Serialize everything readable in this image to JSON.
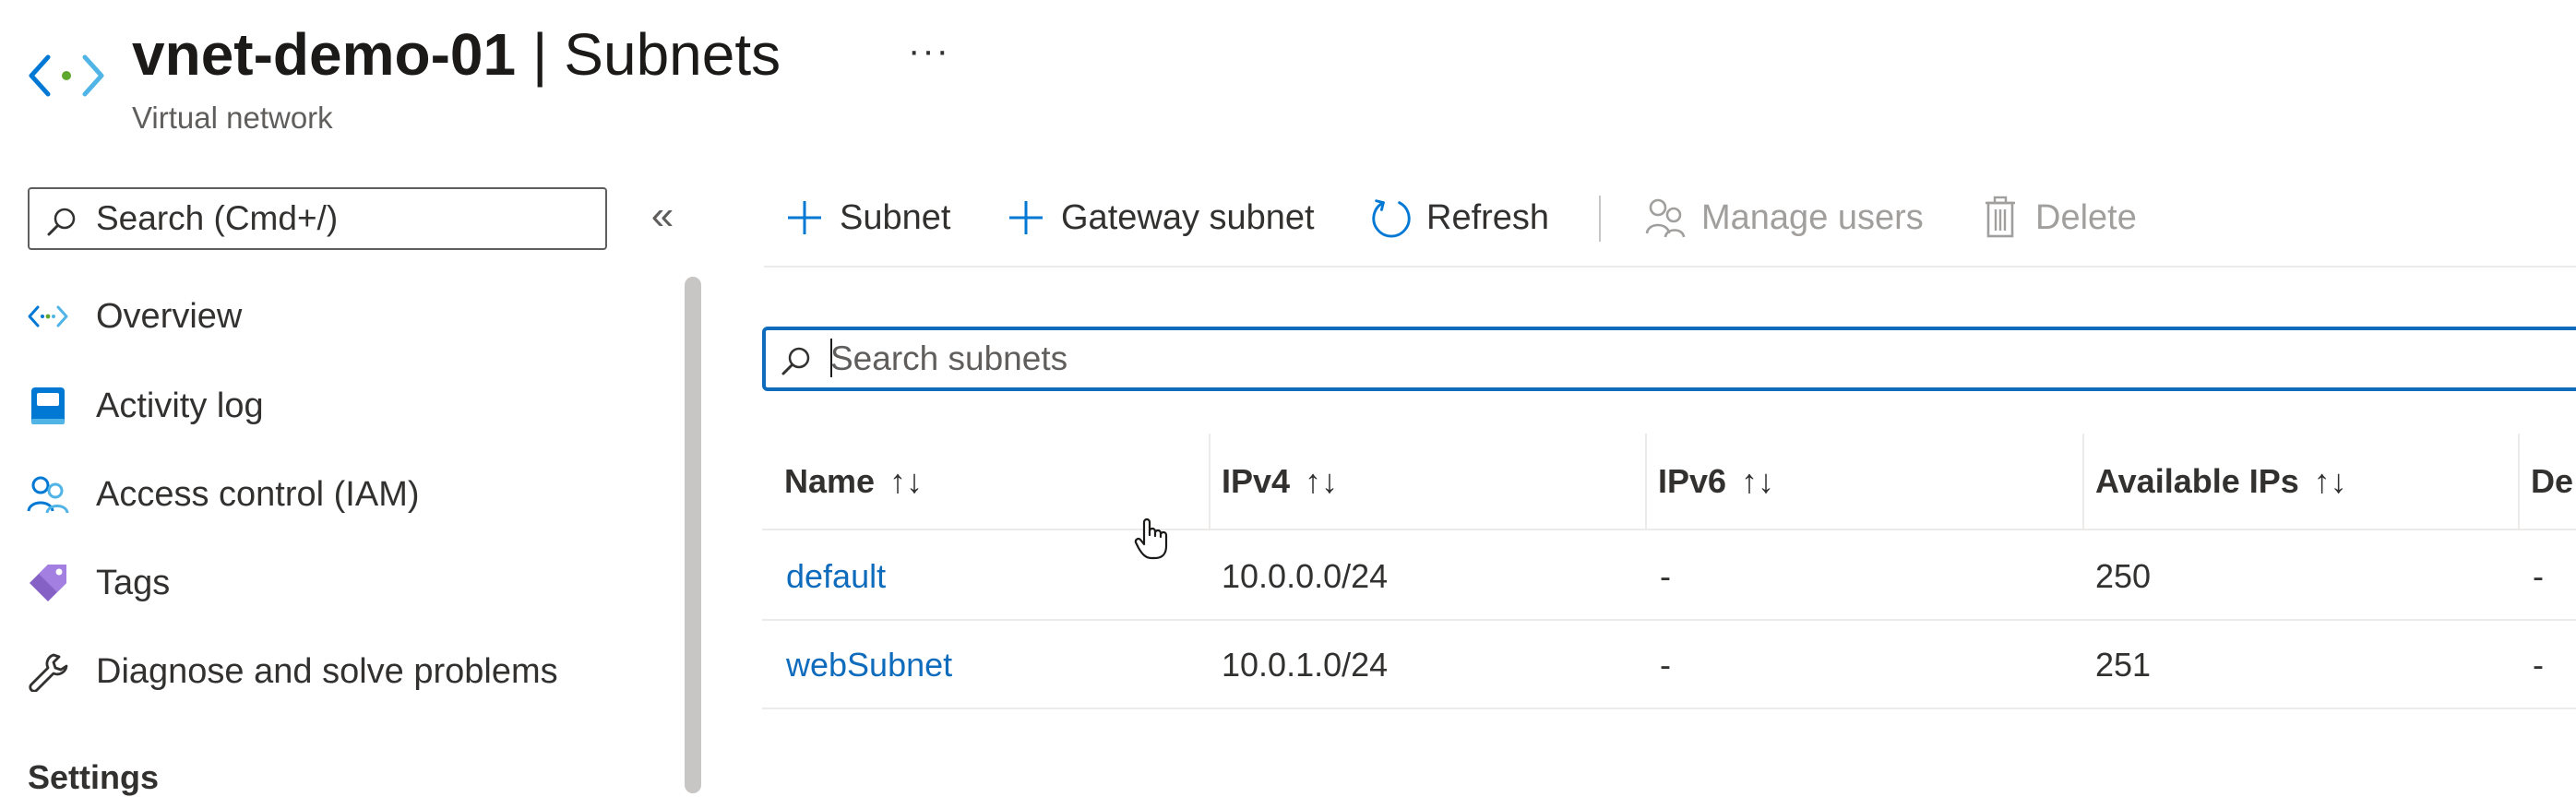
{
  "header": {
    "title_bold": "vnet-demo-01",
    "title_rest": " | Subnets",
    "subtitle": "Virtual network",
    "more_label": "···"
  },
  "sidebar": {
    "search_placeholder": "Search (Cmd+/)",
    "collapse_label": "«",
    "items": [
      {
        "label": "Overview",
        "icon": "vnet-icon"
      },
      {
        "label": "Activity log",
        "icon": "activity-log-icon"
      },
      {
        "label": "Access control (IAM)",
        "icon": "people-icon"
      },
      {
        "label": "Tags",
        "icon": "tag-icon"
      },
      {
        "label": "Diagnose and solve problems",
        "icon": "wrench-icon"
      }
    ],
    "settings_header": "Settings"
  },
  "toolbar": {
    "subnet_label": "Subnet",
    "gateway_label": "Gateway subnet",
    "refresh_label": "Refresh",
    "manage_users_label": "Manage users",
    "delete_label": "Delete"
  },
  "search": {
    "placeholder": "Search subnets"
  },
  "table": {
    "columns": [
      "Name",
      "IPv4",
      "IPv6",
      "Available IPs",
      "De"
    ],
    "sort_glyph": "↑↓",
    "rows": [
      {
        "name": "default",
        "ipv4": "10.0.0.0/24",
        "ipv6": "-",
        "available": "250",
        "desc": "-"
      },
      {
        "name": "webSubnet",
        "ipv4": "10.0.1.0/24",
        "ipv6": "-",
        "available": "251",
        "desc": "-"
      }
    ]
  },
  "colors": {
    "accent": "#0f6cbd",
    "text": "#323130",
    "disabled": "#a19f9d",
    "divider": "#edebe9"
  }
}
